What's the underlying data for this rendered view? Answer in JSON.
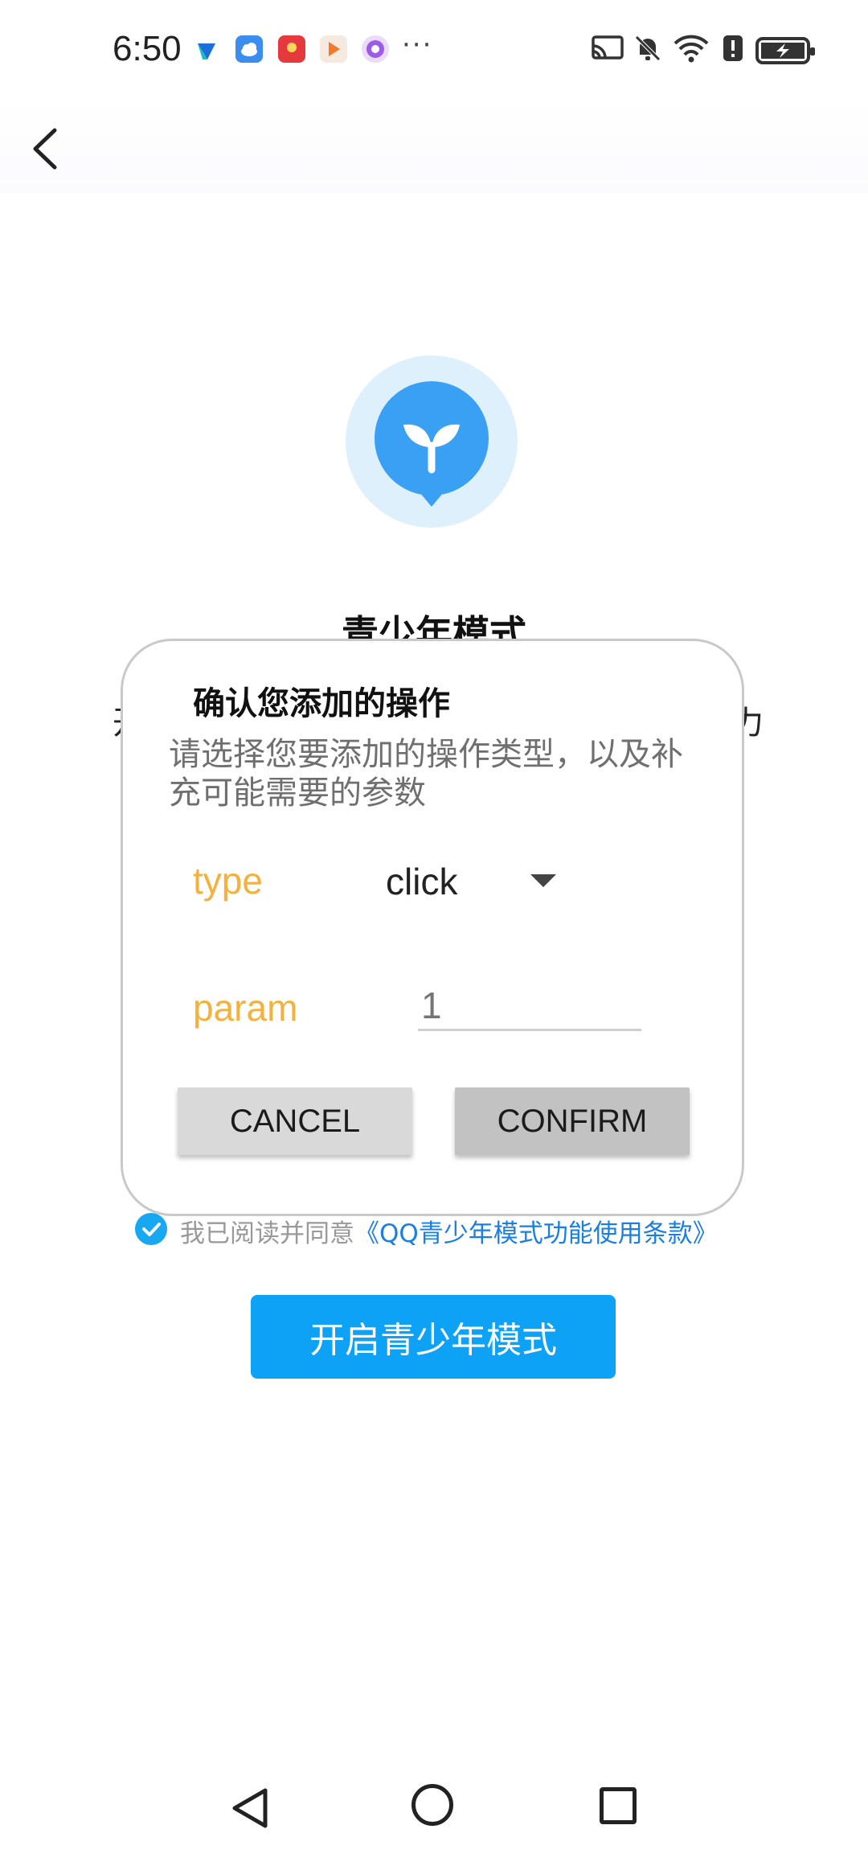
{
  "status_bar": {
    "time": "6:50",
    "more": "···",
    "notification_icons": [
      "app-icon-1",
      "cloud-icon",
      "red-packet-icon",
      "video-icon",
      "app-icon-5"
    ],
    "system_icons": [
      "cast-icon",
      "mute-icon",
      "wifi-icon",
      "alert-icon",
      "battery-charging-icon"
    ]
  },
  "page": {
    "title": "青少年模式",
    "desc_left_fragment": "开",
    "desc_right_fragment": "力",
    "agree_text": "我已阅读并同意",
    "agree_link": "《QQ青少年模式功能使用条款》",
    "primary_button": "开启青少年模式",
    "accent_color": "#0ea2f7"
  },
  "dialog": {
    "title": "确认您添加的操作",
    "description": "请选择您要添加的操作类型，以及补充可能需要的参数",
    "type_label": "type",
    "type_value": "click",
    "param_label": "param",
    "param_placeholder": "1",
    "cancel_label": "CANCEL",
    "confirm_label": "CONFIRM",
    "label_color": "#f4b13d"
  },
  "nav_bar": {
    "icons": [
      "nav-back-icon",
      "nav-home-icon",
      "nav-recents-icon"
    ]
  }
}
